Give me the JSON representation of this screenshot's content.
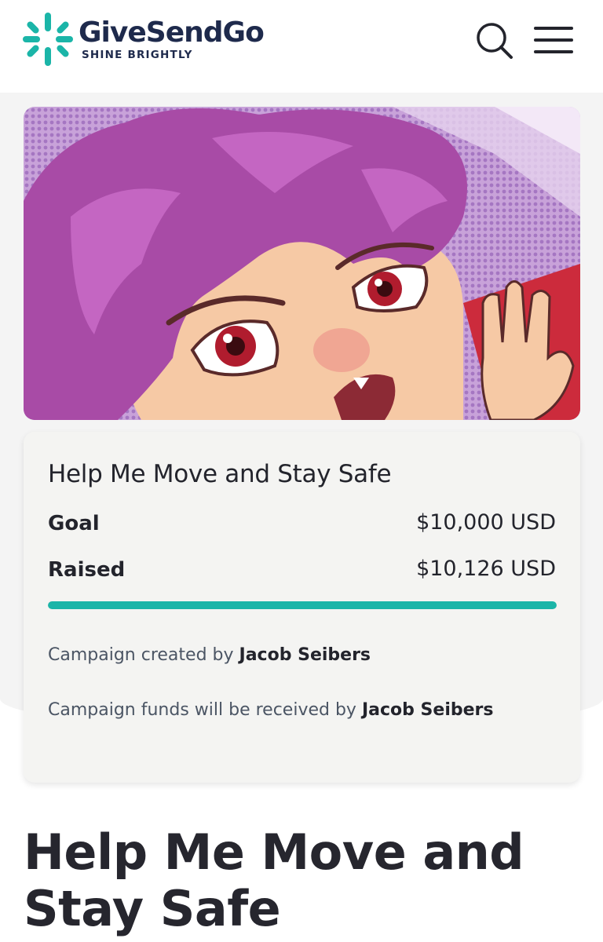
{
  "header": {
    "brand_name": "GiveSendGo",
    "tagline": "SHINE BRIGHTLY",
    "search_icon": "search-icon",
    "menu_icon": "hamburger-menu-icon"
  },
  "colors": {
    "brand_teal": "#1bb5a8",
    "brand_navy": "#1e2a4c",
    "progress": "#1bb5a8"
  },
  "campaign": {
    "title": "Help Me Move and Stay Safe",
    "goal_label": "Goal",
    "goal_value": "$10,000 USD",
    "raised_label": "Raised",
    "raised_value": "$10,126 USD",
    "progress_fraction": 1.0,
    "created_by_text": "Campaign created by",
    "created_by_name": "Jacob Seibers",
    "funds_text": "Campaign funds will be received by",
    "funds_name": "Jacob Seibers"
  },
  "page_title": "Help Me Move and Stay Safe"
}
